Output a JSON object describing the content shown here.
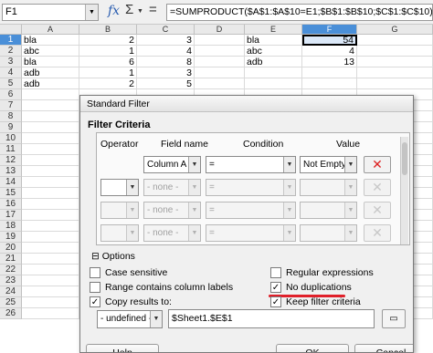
{
  "formula_bar": {
    "cell_ref": "F1",
    "fx_icon": "function-wizard-icon",
    "sigma_icon": "sum-icon",
    "formula": "=SUMPRODUCT($A$1:$A$10=E1;$B$1:$B$10;$C$1:$C$10)"
  },
  "sheet": {
    "columns": [
      "A",
      "B",
      "C",
      "D",
      "E",
      "F",
      "G"
    ],
    "selected_column": "F",
    "rows": [
      "1",
      "2",
      "3",
      "4",
      "5",
      "6",
      "7",
      "8",
      "9",
      "10",
      "11",
      "12",
      "13",
      "14",
      "15",
      "16",
      "17",
      "18",
      "19",
      "20",
      "21",
      "22",
      "23",
      "24",
      "25",
      "26"
    ],
    "selected_row": "1",
    "cells": {
      "A1": "bla",
      "B1": "2",
      "C1": "3",
      "E1": "bla",
      "F1": "54",
      "A2": "abc",
      "B2": "1",
      "C2": "4",
      "E2": "abc",
      "F2": "4",
      "A3": "bla",
      "B3": "6",
      "C3": "8",
      "E3": "adb",
      "F3": "13",
      "A4": "adb",
      "B4": "1",
      "C4": "3",
      "A5": "adb",
      "B5": "2",
      "C5": "5"
    }
  },
  "dialog": {
    "title": "Standard Filter",
    "criteria_title": "Filter Criteria",
    "headers": {
      "operator": "Operator",
      "field_name": "Field name",
      "condition": "Condition",
      "value": "Value"
    },
    "rows": [
      {
        "operator": "",
        "field": "Column A",
        "condition": "=",
        "value": "Not Empty",
        "enabled": true
      },
      {
        "operator": "",
        "field": "- none -",
        "condition": "=",
        "value": "",
        "enabled": false
      },
      {
        "operator": "",
        "field": "- none -",
        "condition": "=",
        "value": "",
        "enabled": false
      },
      {
        "operator": "",
        "field": "- none -",
        "condition": "=",
        "value": "",
        "enabled": false
      }
    ],
    "options_title": "Options",
    "options": {
      "case_sensitive": {
        "label": "Case sensitive",
        "checked": false
      },
      "range_headers": {
        "label": "Range contains column labels",
        "checked": false
      },
      "copy_results": {
        "label": "Copy results to:",
        "checked": true
      },
      "regex": {
        "label": "Regular expressions",
        "checked": false
      },
      "no_duplicates": {
        "label": "No duplications",
        "checked": true
      },
      "keep_criteria": {
        "label": "Keep filter criteria",
        "checked": true
      }
    },
    "copy_target_select": "- undefined -",
    "copy_target_value": "$Sheet1.$E$1",
    "buttons": {
      "help": "Help",
      "ok": "OK",
      "cancel": "Cancel"
    },
    "highlight_color": "#e0202a"
  }
}
